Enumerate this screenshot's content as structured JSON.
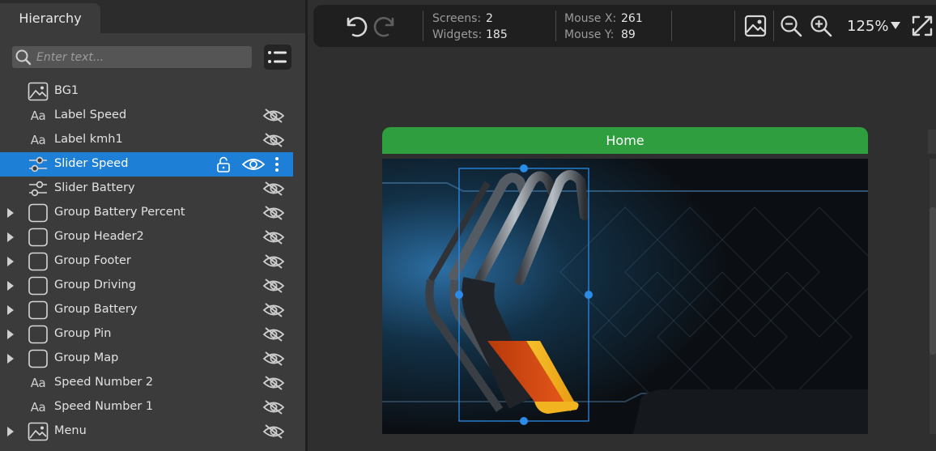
{
  "hierarchy": {
    "tab_label": "Hierarchy",
    "search_placeholder": "Enter text...",
    "items": [
      {
        "label": "BG1",
        "icon": "image-icon",
        "expandable": false,
        "hidden": false,
        "selected": false
      },
      {
        "label": "Label Speed",
        "icon": "text-icon",
        "expandable": false,
        "hidden": true,
        "selected": false
      },
      {
        "label": "Label kmh1",
        "icon": "text-icon",
        "expandable": false,
        "hidden": true,
        "selected": false
      },
      {
        "label": "Slider Speed",
        "icon": "slider-icon",
        "expandable": false,
        "hidden": false,
        "selected": true
      },
      {
        "label": "Slider Battery",
        "icon": "slider-icon",
        "expandable": false,
        "hidden": true,
        "selected": false
      },
      {
        "label": "Group Battery Percent",
        "icon": "group-icon",
        "expandable": true,
        "hidden": true,
        "selected": false
      },
      {
        "label": "Group Header2",
        "icon": "group-icon",
        "expandable": true,
        "hidden": true,
        "selected": false
      },
      {
        "label": "Group Footer",
        "icon": "group-icon",
        "expandable": true,
        "hidden": true,
        "selected": false
      },
      {
        "label": "Group Driving",
        "icon": "group-icon",
        "expandable": true,
        "hidden": true,
        "selected": false
      },
      {
        "label": "Group Battery",
        "icon": "group-icon",
        "expandable": true,
        "hidden": true,
        "selected": false
      },
      {
        "label": "Group Pin",
        "icon": "group-icon",
        "expandable": true,
        "hidden": true,
        "selected": false
      },
      {
        "label": "Group Map",
        "icon": "group-icon",
        "expandable": true,
        "hidden": true,
        "selected": false
      },
      {
        "label": "Speed Number 2",
        "icon": "text-icon",
        "expandable": false,
        "hidden": true,
        "selected": false
      },
      {
        "label": "Speed Number 1",
        "icon": "text-icon",
        "expandable": false,
        "hidden": true,
        "selected": false
      },
      {
        "label": "Menu",
        "icon": "image-icon",
        "expandable": true,
        "hidden": true,
        "selected": false
      }
    ]
  },
  "toolbar": {
    "screens_label": "Screens:",
    "screens_value": "2",
    "widgets_label": "Widgets:",
    "widgets_value": "185",
    "mouse_x_label": "Mouse X:",
    "mouse_x_value": "261",
    "mouse_y_label": "Mouse Y:",
    "mouse_y_value": "89",
    "zoom": "125%"
  },
  "screen": {
    "title": "Home"
  },
  "colors": {
    "selection": "#1e7fd6",
    "screen_header": "#2e9e3f",
    "handle": "#2a8be8",
    "slider_fill_orange": "#d2450e",
    "slider_fill_yellow": "#f0b21c"
  }
}
